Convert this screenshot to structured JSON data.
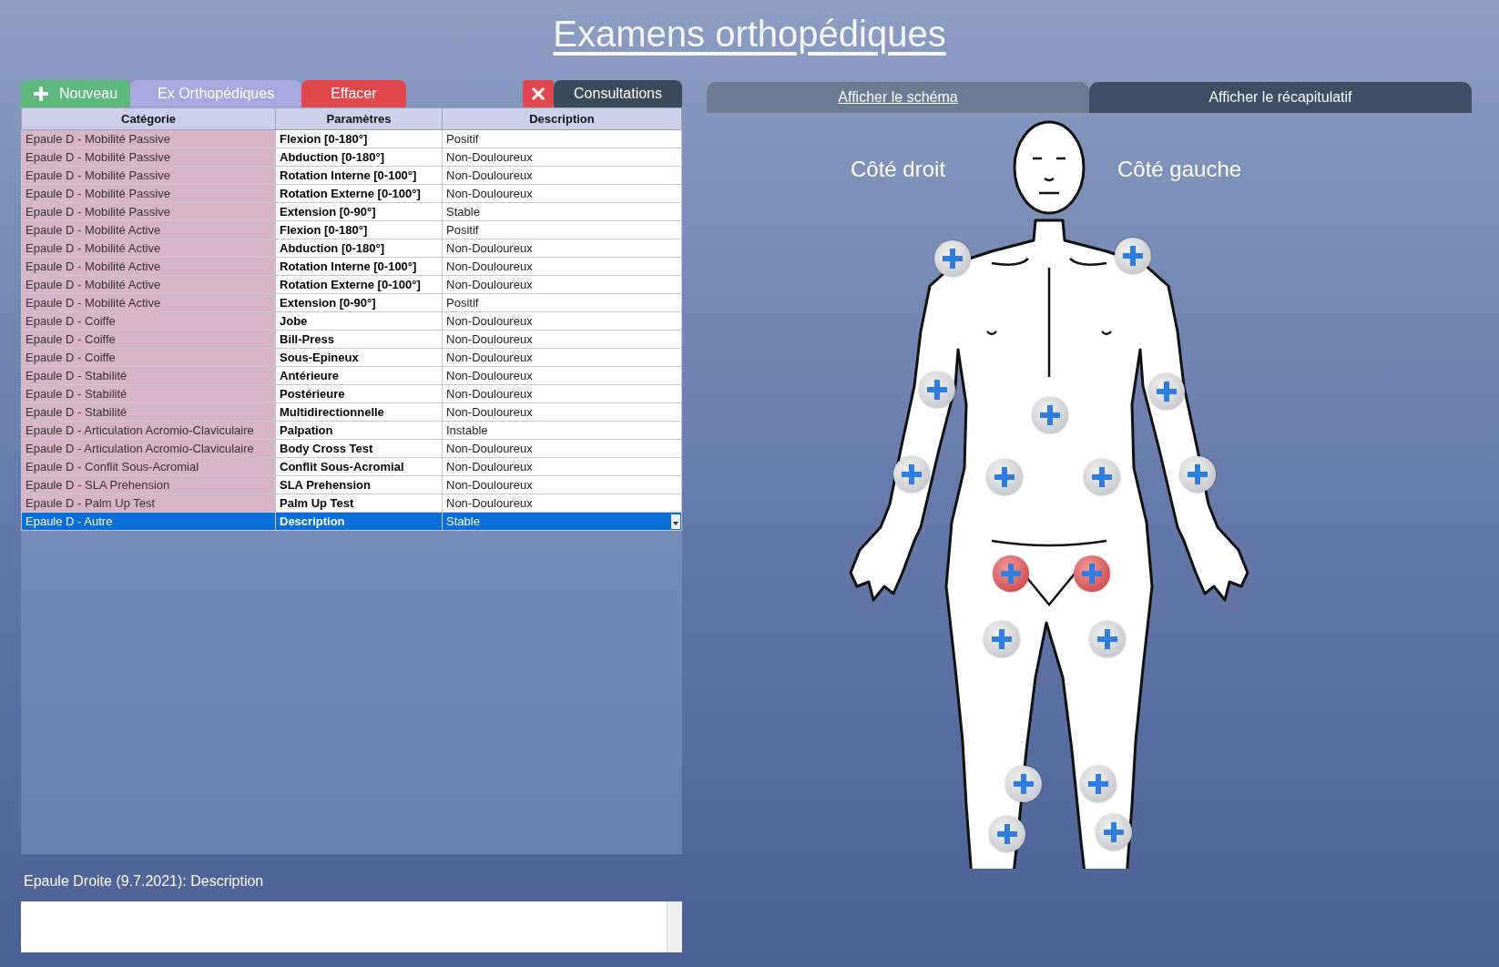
{
  "title": "Examens orthopédiques",
  "toolbar": {
    "new_button": "Nouveau",
    "exams_button": "Ex Orthopédiques",
    "clear_button": "Effacer",
    "consultations_button": "Consultations"
  },
  "view_buttons": {
    "diagram_link": "Afficher le schéma",
    "summary_button": "Afficher le récapitulatif"
  },
  "table": {
    "columns": [
      "Catégorie",
      "Paramètres",
      "Description"
    ],
    "rows": [
      {
        "category": "Epaule D - Mobilité Passive",
        "parameter": "Flexion [0-180°]",
        "description": "Positif",
        "selected": false
      },
      {
        "category": "Epaule D - Mobilité Passive",
        "parameter": "Abduction [0-180°]",
        "description": "Non-Douloureux",
        "selected": false
      },
      {
        "category": "Epaule D - Mobilité Passive",
        "parameter": "Rotation Interne [0-100°]",
        "description": "Non-Douloureux",
        "selected": false
      },
      {
        "category": "Epaule D - Mobilité Passive",
        "parameter": "Rotation Externe [0-100°]",
        "description": "Non-Douloureux",
        "selected": false
      },
      {
        "category": "Epaule D - Mobilité Passive",
        "parameter": "Extension [0-90°]",
        "description": "Stable",
        "selected": false
      },
      {
        "category": "Epaule D - Mobilité Active",
        "parameter": "Flexion [0-180°]",
        "description": "Positif",
        "selected": false
      },
      {
        "category": "Epaule D - Mobilité Active",
        "parameter": "Abduction [0-180°]",
        "description": "Non-Douloureux",
        "selected": false
      },
      {
        "category": "Epaule D - Mobilité Active",
        "parameter": "Rotation Interne [0-100°]",
        "description": "Non-Douloureux",
        "selected": false
      },
      {
        "category": "Epaule D - Mobilité Active",
        "parameter": "Rotation Externe [0-100°]",
        "description": "Non-Douloureux",
        "selected": false
      },
      {
        "category": "Epaule D - Mobilité Active",
        "parameter": "Extension [0-90°]",
        "description": "Positif",
        "selected": false
      },
      {
        "category": "Epaule D - Coiffe",
        "parameter": "Jobe",
        "description": "Non-Douloureux",
        "selected": false
      },
      {
        "category": "Epaule D - Coiffe",
        "parameter": "Bill-Press",
        "description": "Non-Douloureux",
        "selected": false
      },
      {
        "category": "Epaule D - Coiffe",
        "parameter": "Sous-Epineux",
        "description": "Non-Douloureux",
        "selected": false
      },
      {
        "category": "Epaule D - Stabilité",
        "parameter": "Antérieure",
        "description": "Non-Douloureux",
        "selected": false
      },
      {
        "category": "Epaule D - Stabilité",
        "parameter": "Postérieure",
        "description": "Non-Douloureux",
        "selected": false
      },
      {
        "category": "Epaule D - Stabilité",
        "parameter": "Multidirectionnelle",
        "description": "Non-Douloureux",
        "selected": false
      },
      {
        "category": "Epaule D - Articulation Acromio-Claviculaire",
        "parameter": "Palpation",
        "description": "Instable",
        "selected": false
      },
      {
        "category": "Epaule D - Articulation Acromio-Claviculaire",
        "parameter": "Body Cross Test",
        "description": "Non-Douloureux",
        "selected": false
      },
      {
        "category": "Epaule D - Conflit Sous-Acromial",
        "parameter": "Conflit Sous-Acromial",
        "description": "Non-Douloureux",
        "selected": false
      },
      {
        "category": "Epaule D - SLA Prehension",
        "parameter": "SLA Prehension",
        "description": "Non-Douloureux",
        "selected": false
      },
      {
        "category": "Epaule D - Palm Up Test",
        "parameter": "Palm Up Test",
        "description": "Non-Douloureux",
        "selected": false
      },
      {
        "category": "Epaule D - Autre",
        "parameter": "Description",
        "description": "Stable",
        "selected": true
      }
    ]
  },
  "note": {
    "label": "Epaule Droite  (9.7.2021): Description"
  },
  "diagram": {
    "right_side_label": "Côté droit",
    "left_side_label": "Côté gauche",
    "markers": [
      {
        "selected": false
      },
      {
        "selected": false
      },
      {
        "selected": false
      },
      {
        "selected": false
      },
      {
        "selected": false
      },
      {
        "selected": false
      },
      {
        "selected": false
      },
      {
        "selected": false
      },
      {
        "selected": false
      },
      {
        "selected": true
      },
      {
        "selected": true
      },
      {
        "selected": false
      },
      {
        "selected": false
      },
      {
        "selected": false
      },
      {
        "selected": false
      },
      {
        "selected": false
      },
      {
        "selected": false
      }
    ]
  }
}
